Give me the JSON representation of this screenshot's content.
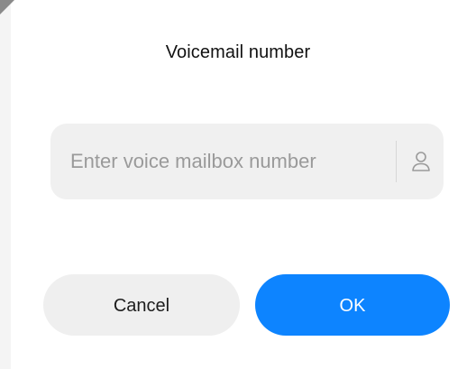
{
  "dialog": {
    "title": "Voicemail number"
  },
  "input": {
    "placeholder": "Enter voice mailbox number",
    "value": "",
    "contact_icon": "contact-person-icon"
  },
  "buttons": {
    "cancel_label": "Cancel",
    "ok_label": "OK"
  },
  "colors": {
    "accent": "#0d84ff",
    "input_bg": "#f0f0f0",
    "cancel_bg": "#efefef",
    "placeholder": "#9a9a9a"
  }
}
